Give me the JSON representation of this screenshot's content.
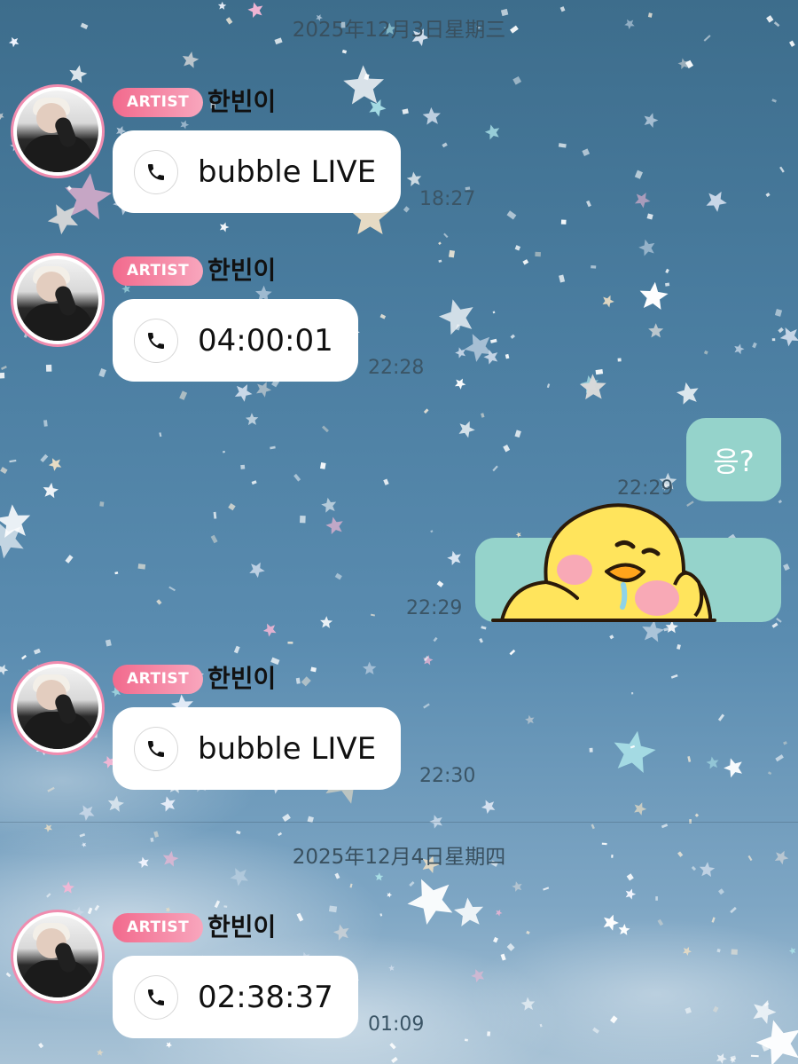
{
  "dates": [
    "2025年12月3日星期三",
    "2025年12月4日星期四"
  ],
  "messages": [
    {
      "badge": "ARTIST",
      "sender": "한빈이",
      "text": "bubble LIVE",
      "time": "18:27"
    },
    {
      "badge": "ARTIST",
      "sender": "한빈이",
      "text": "04:00:01",
      "time": "22:28"
    },
    {
      "badge": "ARTIST",
      "sender": "한빈이",
      "text": "bubble LIVE",
      "time": "22:30"
    },
    {
      "badge": "ARTIST",
      "sender": "한빈이",
      "text": "02:38:37",
      "time": "01:09"
    }
  ],
  "my_messages": [
    {
      "text": "응?",
      "time": "22:29"
    },
    {
      "sticker": "yellow-chick-sticker",
      "time": "22:29"
    }
  ],
  "colors": {
    "badge": "#f26a8d",
    "my_bubble": "#95d3cb",
    "avatar_ring": "#f08caf"
  }
}
